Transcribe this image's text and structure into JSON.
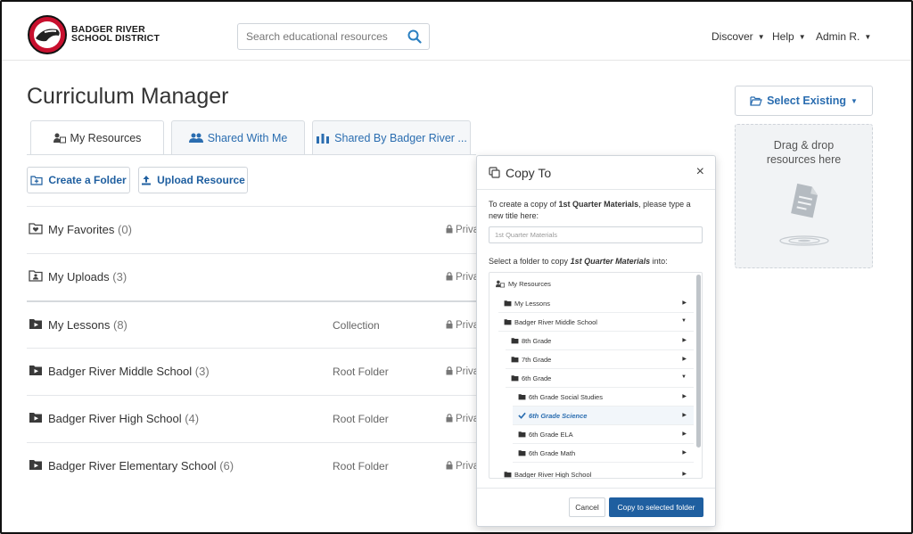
{
  "brand": {
    "name_line1": "BADGER RIVER",
    "name_line2": "SCHOOL DISTRICT"
  },
  "search": {
    "placeholder": "Search educational resources"
  },
  "topnav": {
    "discover": "Discover",
    "help": "Help",
    "user": "Admin R."
  },
  "page": {
    "title": "Curriculum Manager"
  },
  "tabs": [
    {
      "label": "My Resources",
      "active": true
    },
    {
      "label": "Shared With Me",
      "active": false
    },
    {
      "label": "Shared By Badger River ...",
      "active": false
    }
  ],
  "actions": {
    "create_folder": "Create a Folder",
    "upload_resource": "Upload Resource"
  },
  "resources": [
    {
      "name": "My Favorites",
      "count": "(0)",
      "type": "",
      "privacy": "Priva"
    },
    {
      "name": "My Uploads",
      "count": "(3)",
      "type": "",
      "privacy": "Priva"
    },
    {
      "name": "My Lessons",
      "count": "(8)",
      "type": "Collection",
      "privacy": "Priva"
    },
    {
      "name": "Badger River Middle School",
      "count": "(3)",
      "type": "Root Folder",
      "privacy": "Priva"
    },
    {
      "name": "Badger River High School",
      "count": "(4)",
      "type": "Root Folder",
      "privacy": "Priva"
    },
    {
      "name": "Badger River Elementary School",
      "count": "(6)",
      "type": "Root Folder",
      "privacy": "Priva"
    }
  ],
  "sidebar": {
    "select_existing": "Select Existing",
    "dropzone_line1": "Drag & drop",
    "dropzone_line2": "resources here"
  },
  "modal": {
    "title": "Copy To",
    "close": "×",
    "instr_pre": "To create a copy of ",
    "instr_bold": "1st Quarter Materials",
    "instr_post": ", please type a new title here:",
    "input_value": "1st Quarter Materials",
    "select_pre": "Select a folder to copy ",
    "select_bold": "1st Quarter Materials",
    "select_post": " into:",
    "tree": [
      {
        "label": "My Resources",
        "depth": 0,
        "arrow": "",
        "kind": "root"
      },
      {
        "label": "My Lessons",
        "depth": 1,
        "arrow": "▶",
        "kind": "folder"
      },
      {
        "label": "Badger River Middle School",
        "depth": 1,
        "arrow": "▼",
        "kind": "folder"
      },
      {
        "label": "8th Grade",
        "depth": 2,
        "arrow": "▶",
        "kind": "folder"
      },
      {
        "label": "7th Grade",
        "depth": 2,
        "arrow": "▶",
        "kind": "folder"
      },
      {
        "label": "6th Grade",
        "depth": 2,
        "arrow": "▼",
        "kind": "folder"
      },
      {
        "label": "6th Grade Social Studies",
        "depth": 3,
        "arrow": "▶",
        "kind": "folder"
      },
      {
        "label": "6th Grade Science",
        "depth": 3,
        "arrow": "▶",
        "kind": "selected"
      },
      {
        "label": "6th Grade ELA",
        "depth": 3,
        "arrow": "▶",
        "kind": "folder"
      },
      {
        "label": "6th Grade Math",
        "depth": 3,
        "arrow": "▶",
        "kind": "folder"
      },
      {
        "label": "Badger River High School",
        "depth": 1,
        "arrow": "▶",
        "kind": "folder"
      }
    ],
    "cancel": "Cancel",
    "copy": "Copy to selected folder"
  },
  "colors": {
    "accent": "#1f5fa0",
    "link": "#2a6db0",
    "border": "#cfd4da"
  }
}
